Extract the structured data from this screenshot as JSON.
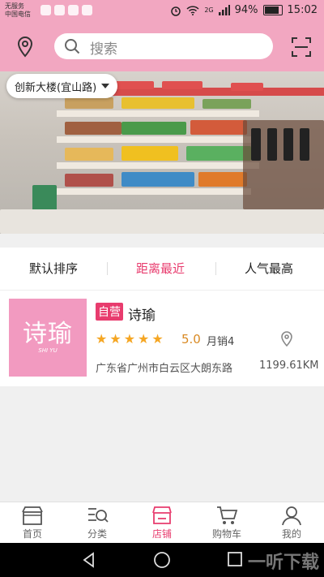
{
  "status_bar": {
    "carrier_line1": "无服务",
    "carrier_line2": "中国电信",
    "network": "2G",
    "battery": "94%",
    "time": "15:02"
  },
  "header": {
    "search_placeholder": "搜索",
    "location": "创新大楼(宜山路)"
  },
  "sort_tabs": [
    {
      "label": "默认排序",
      "active": false
    },
    {
      "label": "距离最近",
      "active": true
    },
    {
      "label": "人气最高",
      "active": false
    }
  ],
  "store": {
    "badge": "自营",
    "name": "诗瑜",
    "logo_text": "诗瑜",
    "logo_sub": "SHI YU",
    "rating_value": "5.0",
    "stars": 5,
    "sales": "月销4",
    "address": "广东省广州市白云区大朗东路",
    "distance": "1199.61KM"
  },
  "bottom_nav": [
    {
      "label": "首页",
      "icon": "shop-icon",
      "active": false
    },
    {
      "label": "分类",
      "icon": "category-search-icon",
      "active": false
    },
    {
      "label": "店铺",
      "icon": "store-icon",
      "active": true
    },
    {
      "label": "购物车",
      "icon": "cart-icon",
      "active": false
    },
    {
      "label": "我的",
      "icon": "user-icon",
      "active": false
    }
  ],
  "watermark": "一听下载",
  "colors": {
    "brand_pink": "#f2a7c1",
    "accent": "#e83c6e",
    "star": "#f5a623"
  }
}
